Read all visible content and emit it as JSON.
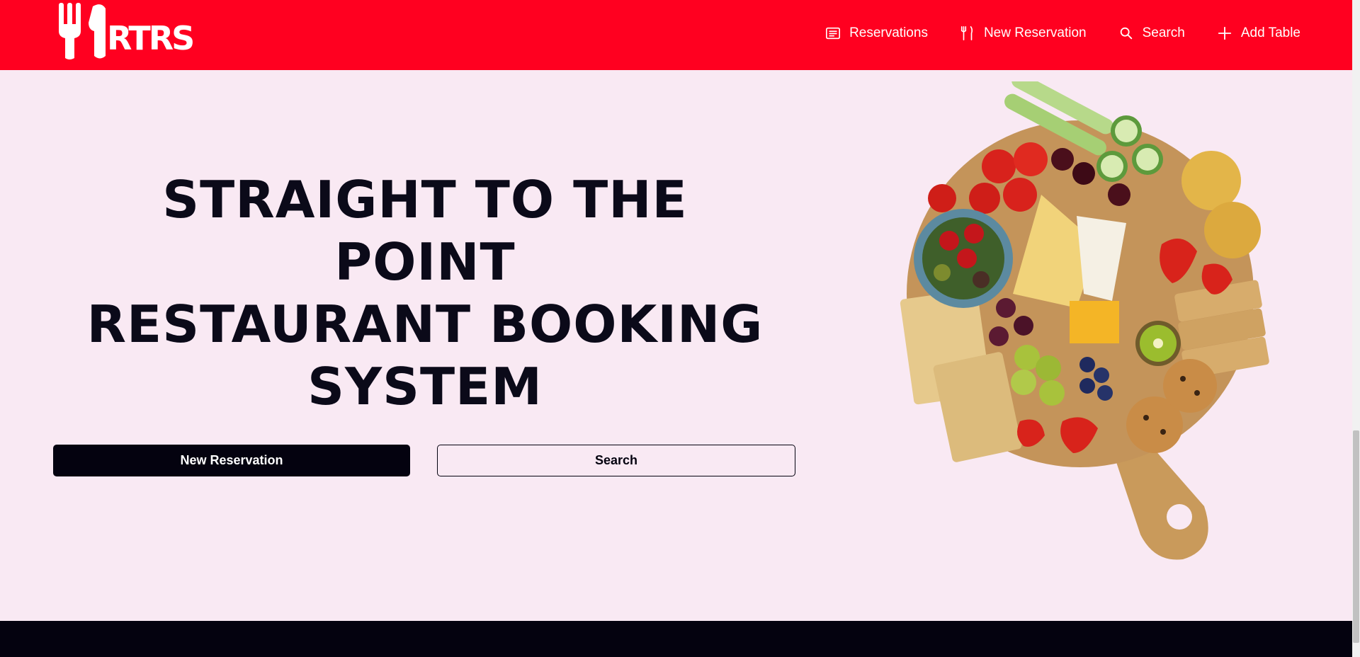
{
  "brand": {
    "logo_text": "RTRS",
    "primary_color": "#ff0020",
    "dark_color": "#04020f",
    "background_color": "#f9e9f3"
  },
  "nav": {
    "items": [
      {
        "label": "Reservations",
        "icon": "list-icon"
      },
      {
        "label": "New Reservation",
        "icon": "fork-knife-icon"
      },
      {
        "label": "Search",
        "icon": "search-icon"
      },
      {
        "label": "Add Table",
        "icon": "plus-icon"
      }
    ]
  },
  "hero": {
    "title_line1": "STRAIGHT TO THE POINT",
    "title_line2": "RESTAURANT BOOKING",
    "title_line3": "SYSTEM",
    "primary_button": "New Reservation",
    "secondary_button": "Search",
    "image": "charcuterie-board-image"
  }
}
